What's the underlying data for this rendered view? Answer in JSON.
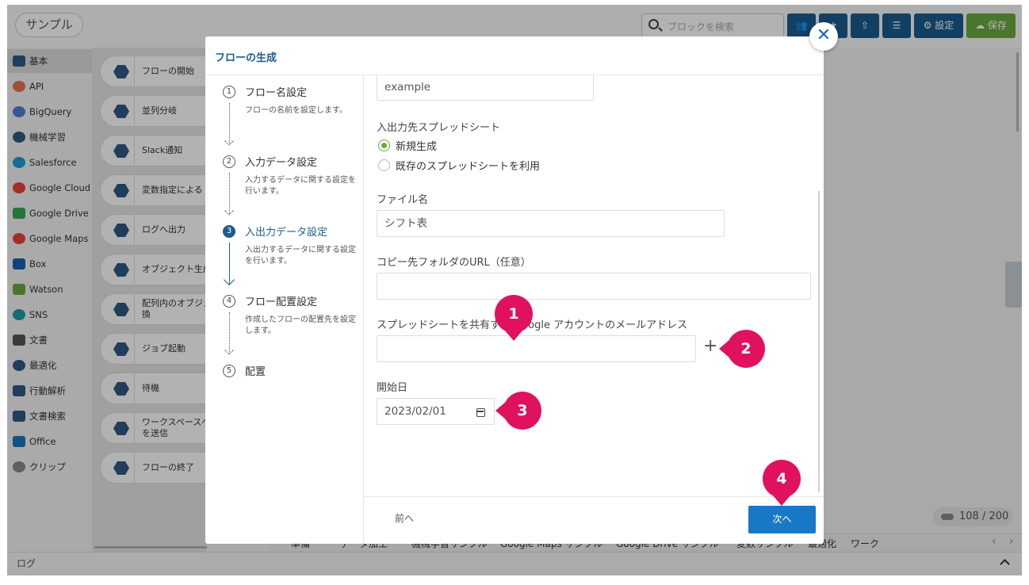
{
  "app": {
    "title": "サンプル"
  },
  "toolbar": {
    "search_placeholder": "ブロックを検索",
    "settings_label": "設定",
    "save_label": "保存"
  },
  "categories": [
    {
      "label": "基本",
      "icon": "cube-icon",
      "color": "#2e5a85"
    },
    {
      "label": "API",
      "icon": "api-icon",
      "color": "#e8734a"
    },
    {
      "label": "BigQuery",
      "icon": "bigquery-icon",
      "color": "#4a7fd6"
    },
    {
      "label": "機械学習",
      "icon": "brain-icon",
      "color": "#2e5a85"
    },
    {
      "label": "Salesforce",
      "icon": "cloud-icon",
      "color": "#1a9ed9"
    },
    {
      "label": "Google Cloud",
      "icon": "google-cloud-icon",
      "color": "#ea4335"
    },
    {
      "label": "Google Drive",
      "icon": "google-drive-icon",
      "color": "#34a853"
    },
    {
      "label": "Google Maps",
      "icon": "map-pin-icon",
      "color": "#ea4335"
    },
    {
      "label": "Box",
      "icon": "box-icon",
      "color": "#1a5fb4"
    },
    {
      "label": "Watson",
      "icon": "watson-icon",
      "color": "#6aaa40"
    },
    {
      "label": "SNS",
      "icon": "chat-bubble-icon",
      "color": "#1a9ea0"
    },
    {
      "label": "文書",
      "icon": "document-icon",
      "color": "#555555"
    },
    {
      "label": "最適化",
      "icon": "atom-icon",
      "color": "#2e5a85"
    },
    {
      "label": "行動解析",
      "icon": "running-person-icon",
      "color": "#2e5a85"
    },
    {
      "label": "文書検索",
      "icon": "search-doc-icon",
      "color": "#2e5a85"
    },
    {
      "label": "Office",
      "icon": "office-icon",
      "color": "#1a78c2"
    },
    {
      "label": "クリップ",
      "icon": "paperclip-icon",
      "color": "#555555"
    }
  ],
  "palette_blocks": [
    "フローの開始",
    "並列分岐",
    "Slack通知",
    "変数指定による S",
    "ログへ出力",
    "オブジェクト生成",
    "配列内のオブジェ 変換",
    "ジョブ起動",
    "待機",
    "ワークスペースへ ジを送信",
    "フローの終了"
  ],
  "canvas": {
    "counter": "108 / 200"
  },
  "bottom_tabs": [
    "準備",
    "データ加工",
    "機械学習サンプル",
    "Google Maps サンプル",
    "Google Drive サンプル",
    "変数サンプル",
    "最適化",
    "ワーク"
  ],
  "log_label": "ログ",
  "modal": {
    "title": "フローの生成",
    "steps": [
      {
        "num": "1",
        "title": "フロー名設定",
        "desc": "フローの名前を設定します。"
      },
      {
        "num": "2",
        "title": "入力データ設定",
        "desc": "入力するデータに関する設定を行います。"
      },
      {
        "num": "3",
        "title": "入出力データ設定",
        "desc": "入出力するデータに関する設定を行います。"
      },
      {
        "num": "4",
        "title": "フロー配置設定",
        "desc": "作成したフローの配置先を設定します。"
      },
      {
        "num": "5",
        "title": "配置",
        "desc": ""
      }
    ],
    "form": {
      "name_value": "example",
      "spreadsheet_label": "入出力先スプレッドシート",
      "radio_new": "新規生成",
      "radio_existing": "既存のスプレッドシートを利用",
      "filename_label": "ファイル名",
      "filename_value": "シフト表",
      "copy_folder_label": "コピー先フォルダのURL（任意）",
      "copy_folder_value": "",
      "share_email_label": "スプレッドシートを共有する Google アカウントのメールアドレス",
      "share_email_value": "",
      "start_date_label": "開始日",
      "start_date_value": "2023/02/01"
    },
    "prev_label": "前へ",
    "next_label": "次へ"
  },
  "callouts": [
    "1",
    "2",
    "3",
    "4"
  ],
  "colors": {
    "accent": "#1b5c8e",
    "callout": "#e0115f",
    "next": "#1878c8",
    "radio": "#6aaa40"
  }
}
